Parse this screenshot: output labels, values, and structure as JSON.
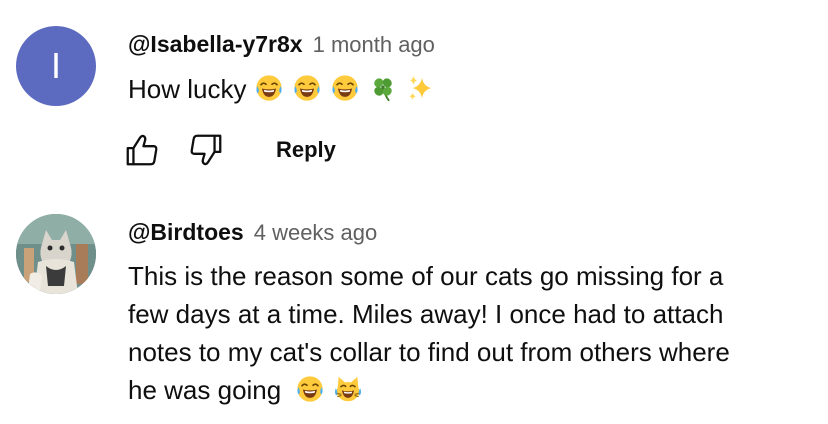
{
  "comments": [
    {
      "author": "@Isabella-y7r8x",
      "time": "1 month ago",
      "avatar_letter": "I",
      "avatar_color": "#5c6bc0",
      "text": "How lucky",
      "emojis": [
        "face-with-tears-of-joy",
        "face-with-tears-of-joy",
        "face-with-tears-of-joy",
        "four-leaf-clover",
        "sparkles"
      ],
      "actions": {
        "like_icon": "thumbs-up-icon",
        "dislike_icon": "thumbs-down-icon",
        "reply_label": "Reply"
      }
    },
    {
      "author": "@Birdtoes",
      "time": "4 weeks ago",
      "avatar_image": "cat-photo-avatar",
      "text_lines": [
        "This is the reason some of our cats go missing for a",
        "few days at a time.  Miles away!  I once had to attach",
        "notes to my cat's collar to find out from others where",
        "he was going"
      ],
      "emojis": [
        "face-with-tears-of-joy",
        "cat-with-tears-of-joy"
      ]
    }
  ],
  "colors": {
    "text_primary": "#0f0f0f",
    "text_secondary": "#606060",
    "avatar_bg": "#5c6bc0"
  }
}
